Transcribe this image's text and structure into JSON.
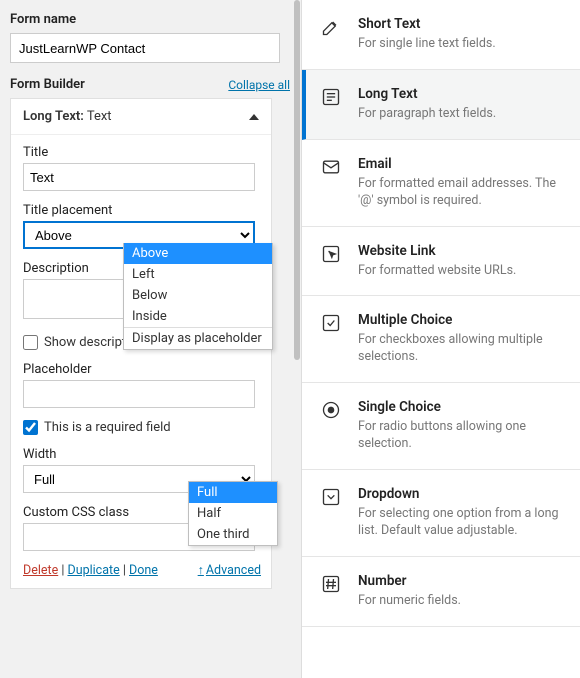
{
  "left": {
    "form_name_label": "Form name",
    "form_name_value": "JustLearnWP Contact",
    "builder_label": "Form Builder",
    "collapse_all": "Collapse all",
    "panel_title_strong": "Long Text:",
    "panel_title_rest": " Text",
    "title_label": "Title",
    "title_value": "Text",
    "title_placement_label": "Title placement",
    "title_placement_value": "Above",
    "title_placement_options": [
      "Above",
      "Left",
      "Below",
      "Inside",
      "Display as placeholder"
    ],
    "description_label": "Description",
    "show_tooltip_label": "Show description in a tooltip",
    "placeholder_label": "Placeholder",
    "required_label": "This is a required field",
    "width_label": "Width",
    "width_value": "Full",
    "width_options": [
      "Full",
      "Half",
      "One third"
    ],
    "css_label": "Custom CSS class",
    "actions": {
      "delete": "Delete",
      "duplicate": "Duplicate",
      "done": "Done",
      "advanced": "Advanced"
    }
  },
  "fields": [
    {
      "id": "short-text",
      "title": "Short Text",
      "desc": "For single line text fields.",
      "icon": "pencil",
      "active": false
    },
    {
      "id": "long-text",
      "title": "Long Text",
      "desc": "For paragraph text fields.",
      "icon": "lines",
      "active": true
    },
    {
      "id": "email",
      "title": "Email",
      "desc": "For formatted email addresses. The '@' symbol is required.",
      "icon": "mail",
      "active": false
    },
    {
      "id": "website",
      "title": "Website Link",
      "desc": "For formatted website URLs.",
      "icon": "cursor",
      "active": false
    },
    {
      "id": "multiple",
      "title": "Multiple Choice",
      "desc": "For checkboxes allowing multiple selections.",
      "icon": "check",
      "active": false
    },
    {
      "id": "single",
      "title": "Single Choice",
      "desc": "For radio buttons allowing one selection.",
      "icon": "radio",
      "active": false
    },
    {
      "id": "dropdown",
      "title": "Dropdown",
      "desc": "For selecting one option from a long list. Default value adjustable.",
      "icon": "chevdown",
      "active": false
    },
    {
      "id": "number",
      "title": "Number",
      "desc": "For numeric fields.",
      "icon": "hash",
      "active": false
    }
  ]
}
